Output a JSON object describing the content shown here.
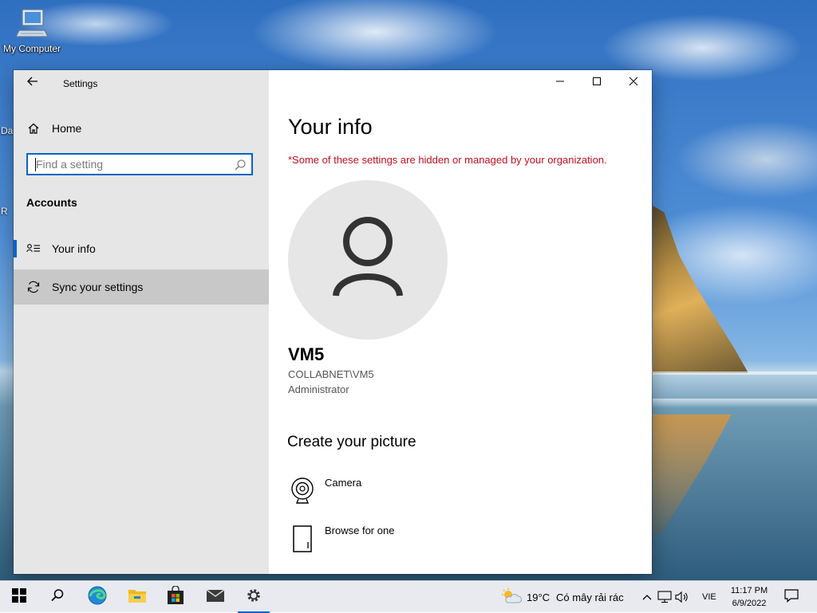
{
  "desktop": {
    "icons": [
      {
        "label": "My Computer",
        "icon": "computer-icon"
      }
    ],
    "edge_fragments": [
      "Da",
      "R"
    ]
  },
  "window": {
    "title": "Settings",
    "controls": {
      "minimize": "minimize-icon",
      "maximize": "maximize-icon",
      "close": "close-icon"
    }
  },
  "sidebar": {
    "home_label": "Home",
    "search": {
      "placeholder": "Find a setting",
      "value": ""
    },
    "section_title": "Accounts",
    "items": [
      {
        "label": "Your info",
        "icon": "contact-card-icon",
        "selected": true
      },
      {
        "label": "Sync your settings",
        "icon": "sync-icon",
        "selected": false
      }
    ]
  },
  "content": {
    "title": "Your info",
    "org_notice": "*Some of these settings are hidden or managed by your organization.",
    "user": {
      "name": "VM5",
      "account": "COLLABNET\\VM5",
      "role": "Administrator"
    },
    "create_picture": {
      "heading": "Create your picture",
      "options": [
        {
          "label": "Camera",
          "icon": "camera-icon"
        },
        {
          "label": "Browse for one",
          "icon": "document-icon"
        }
      ]
    }
  },
  "taskbar": {
    "apps": [
      "windows-start",
      "search",
      "edge",
      "file-explorer",
      "store",
      "mail",
      "settings"
    ],
    "active_app": "settings",
    "weather": {
      "temp": "19°C",
      "condition": "Có mây rải rác"
    },
    "language": "VIE",
    "time": "11:17 PM",
    "date": "6/9/2022"
  },
  "colors": {
    "accent": "#0a64c8",
    "warning_text": "#c50f1f",
    "sidebar_bg": "#e6e6e6",
    "content_bg": "#ffffff",
    "taskbar_bg": "#e8eaef"
  }
}
